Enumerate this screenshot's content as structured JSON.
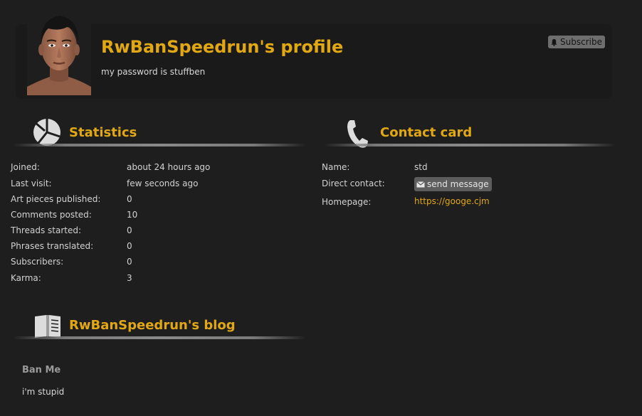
{
  "profile": {
    "title": "RwBanSpeedrun's profile",
    "bio": "my password is stuffben",
    "subscribe_label": "Subscribe"
  },
  "statistics": {
    "heading": "Statistics",
    "rows": [
      {
        "label": "Joined:",
        "value": "about 24 hours ago"
      },
      {
        "label": "Last visit:",
        "value": "few seconds ago"
      },
      {
        "label": "Art pieces published:",
        "value": "0"
      },
      {
        "label": "Comments posted:",
        "value": "10"
      },
      {
        "label": "Threads started:",
        "value": "0"
      },
      {
        "label": "Phrases translated:",
        "value": "0"
      },
      {
        "label": "Subscribers:",
        "value": "0"
      },
      {
        "label": "Karma:",
        "value": "3"
      }
    ]
  },
  "contact": {
    "heading": "Contact card",
    "name_label": "Name:",
    "name_value": "std",
    "direct_label": "Direct contact:",
    "send_message_label": "send message",
    "homepage_label": "Homepage:",
    "homepage_value": "https://googe.cjm"
  },
  "blog": {
    "heading": "RwBanSpeedrun's blog",
    "posts": [
      {
        "title": "Ban Me",
        "body": "i'm stupid"
      }
    ]
  },
  "colors": {
    "accent": "#e2a814",
    "background": "#1e1e1e",
    "card": "#1a1a1a"
  }
}
